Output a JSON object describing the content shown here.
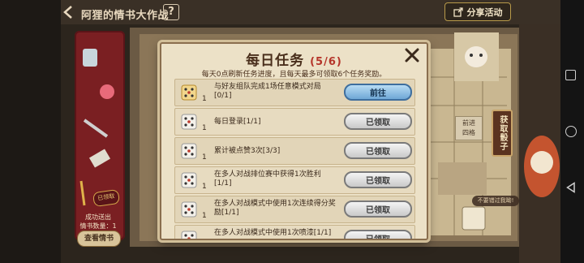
{
  "top_bar": {
    "title": "阿狸的情书大作战",
    "help": "?",
    "share_label": "分享活动"
  },
  "left_panel": {
    "progress_text": "成功送出\n情书数量：1",
    "view_button": "查看情书",
    "claimed_stamp": "已领取"
  },
  "board": {
    "get_dice": "获取骰子",
    "forward": "前进\n四格",
    "hint": "不要错过我呦!"
  },
  "modal": {
    "title": "每日任务",
    "count": "(5/6)",
    "subtitle": "每天0点刷新任务进度，且每天最多可领取6个任务奖励。",
    "tasks": [
      {
        "qty": "1",
        "desc": "与好友组队完成1场任意模式对局[0/1]",
        "button": "前往",
        "state": "go",
        "dice": "gold"
      },
      {
        "qty": "1",
        "desc": "每日登录[1/1]",
        "button": "已领取",
        "state": "done",
        "dice": "white"
      },
      {
        "qty": "1",
        "desc": "累计被点赞3次[3/3]",
        "button": "已领取",
        "state": "done",
        "dice": "white"
      },
      {
        "qty": "1",
        "desc": "在多人对战排位赛中获得1次胜利[1/1]",
        "button": "已领取",
        "state": "done",
        "dice": "white"
      },
      {
        "qty": "1",
        "desc": "在多人对战模式中使用1次连续得分奖励[1/1]",
        "button": "已领取",
        "state": "done",
        "dice": "white"
      },
      {
        "qty": "",
        "desc": "在多人对战模式中使用1次喷漆[1/1]",
        "button": "已领取",
        "state": "done",
        "dice": "white"
      }
    ]
  },
  "colors": {
    "accent_red": "#b5352a",
    "go_blue": "#6fa7d6",
    "panel": "#ece1c7"
  }
}
